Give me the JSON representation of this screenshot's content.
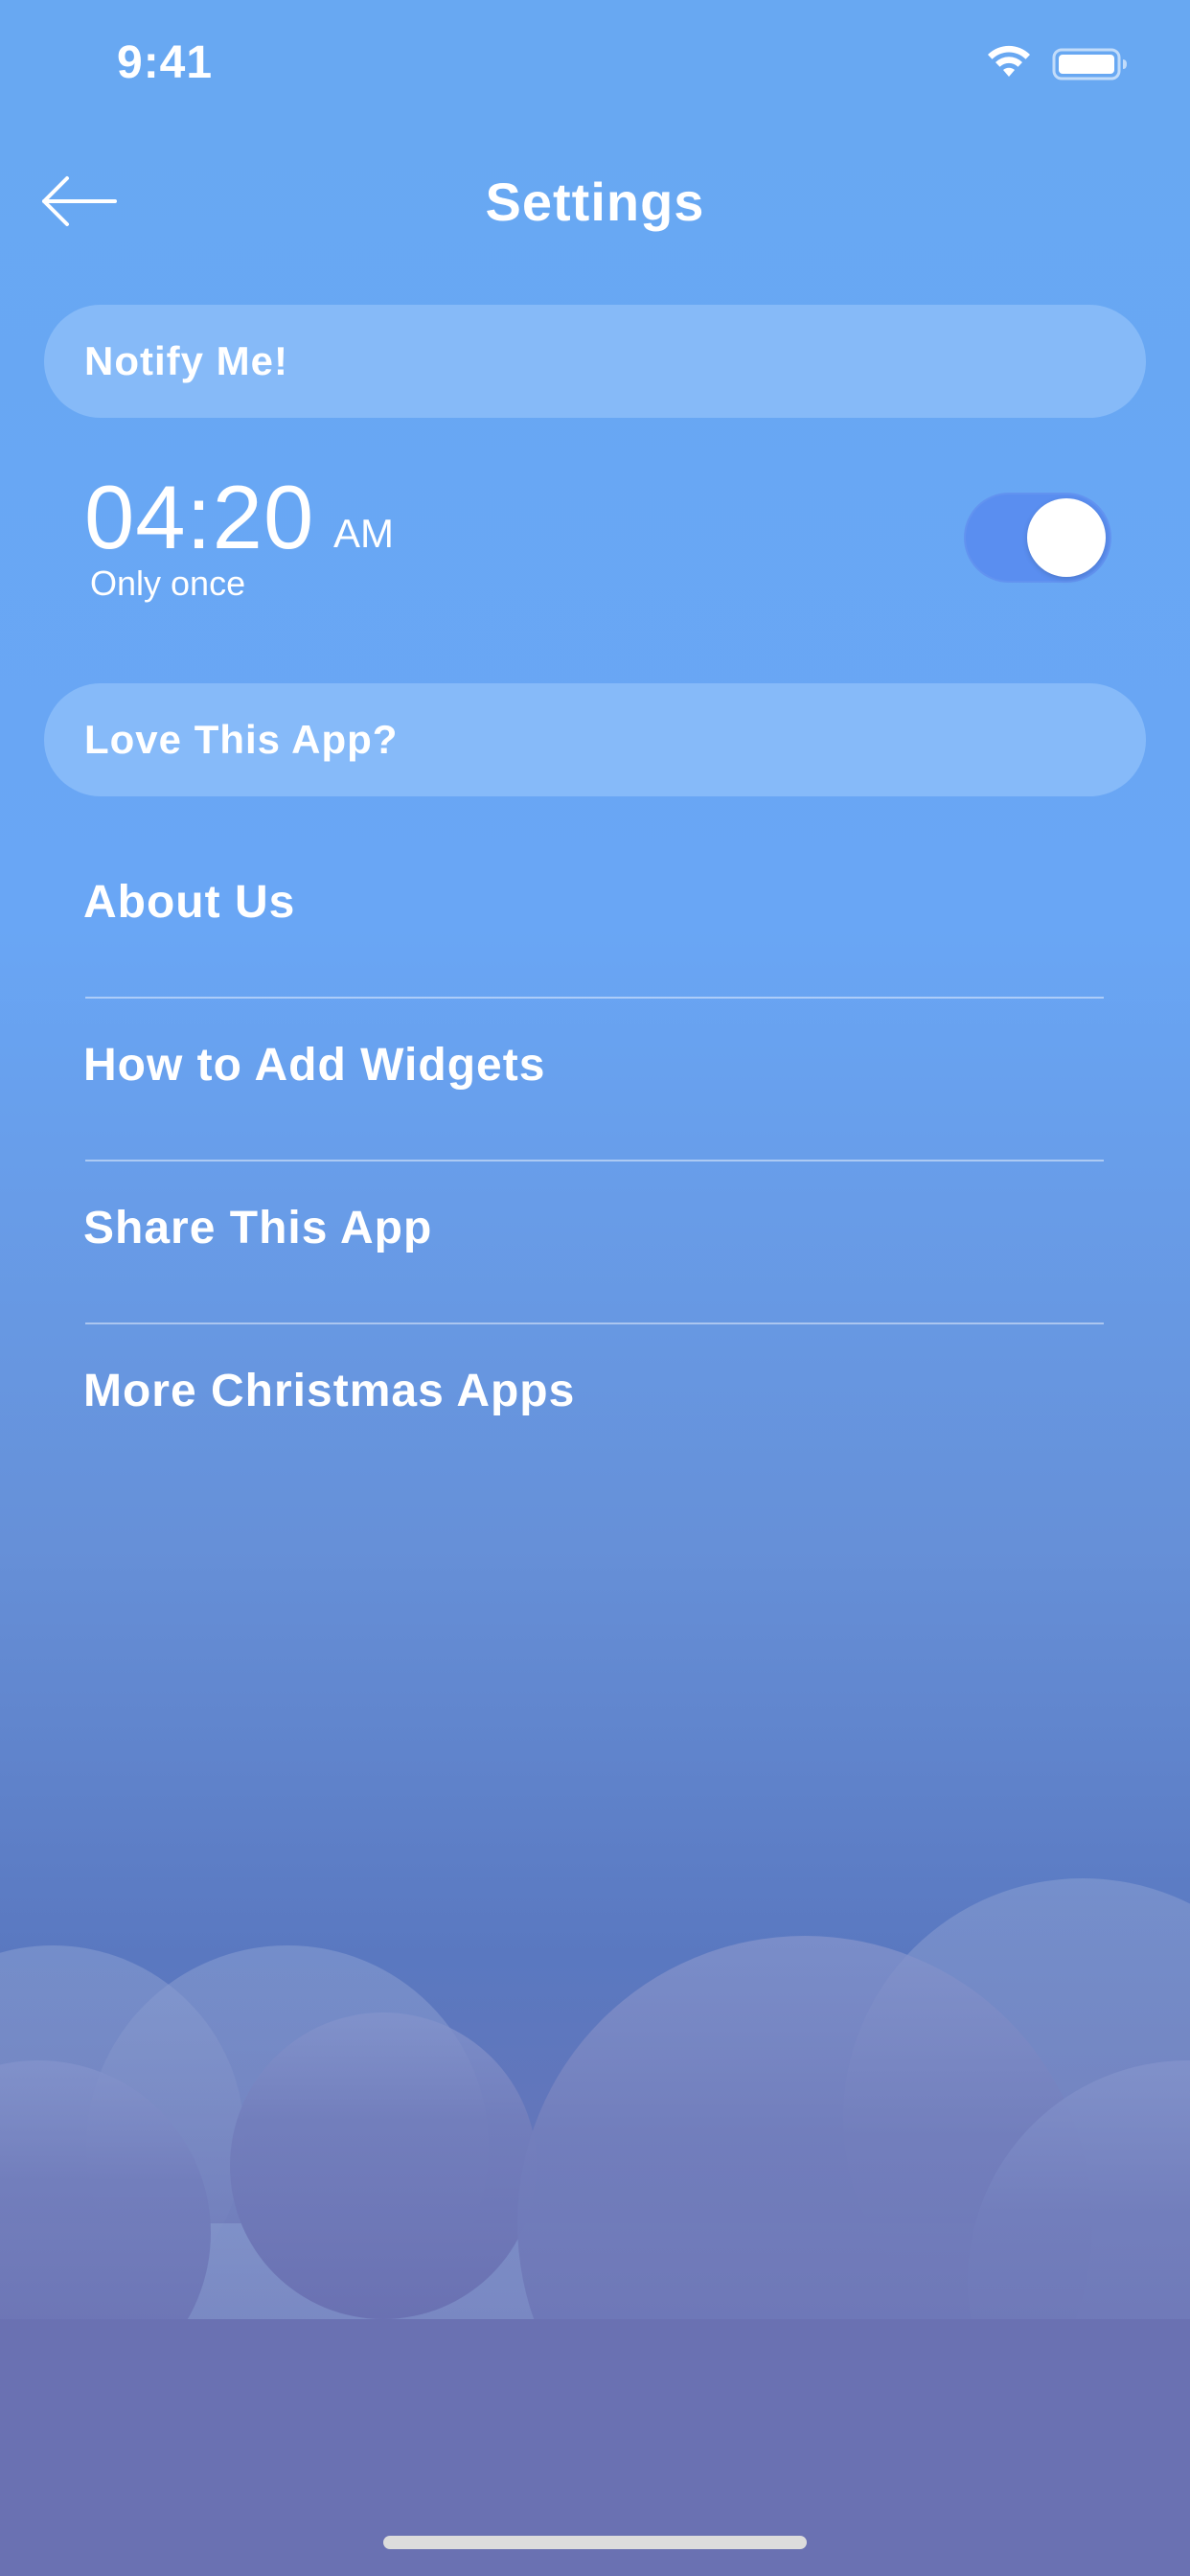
{
  "status_bar": {
    "time": "9:41",
    "wifi_icon": "wifi-icon",
    "battery_icon": "battery-icon"
  },
  "header": {
    "back_icon": "arrow-left-icon",
    "title": "Settings"
  },
  "sections": {
    "notify": {
      "label": "Notify Me!"
    },
    "love": {
      "label": "Love This App?"
    }
  },
  "alarm": {
    "time": "04:20",
    "period": "AM",
    "repeat": "Only once",
    "enabled": true
  },
  "menu": {
    "items": [
      {
        "label": "About Us"
      },
      {
        "label": "How to Add Widgets"
      },
      {
        "label": "Share This App"
      },
      {
        "label": "More Christmas Apps"
      }
    ]
  },
  "colors": {
    "background_top": "#68a8f2",
    "background_bottom": "#6a72b2",
    "toggle_on": "#5a8ef0",
    "section_pill": "rgba(170,210,255,0.45)",
    "text": "#ffffff"
  }
}
